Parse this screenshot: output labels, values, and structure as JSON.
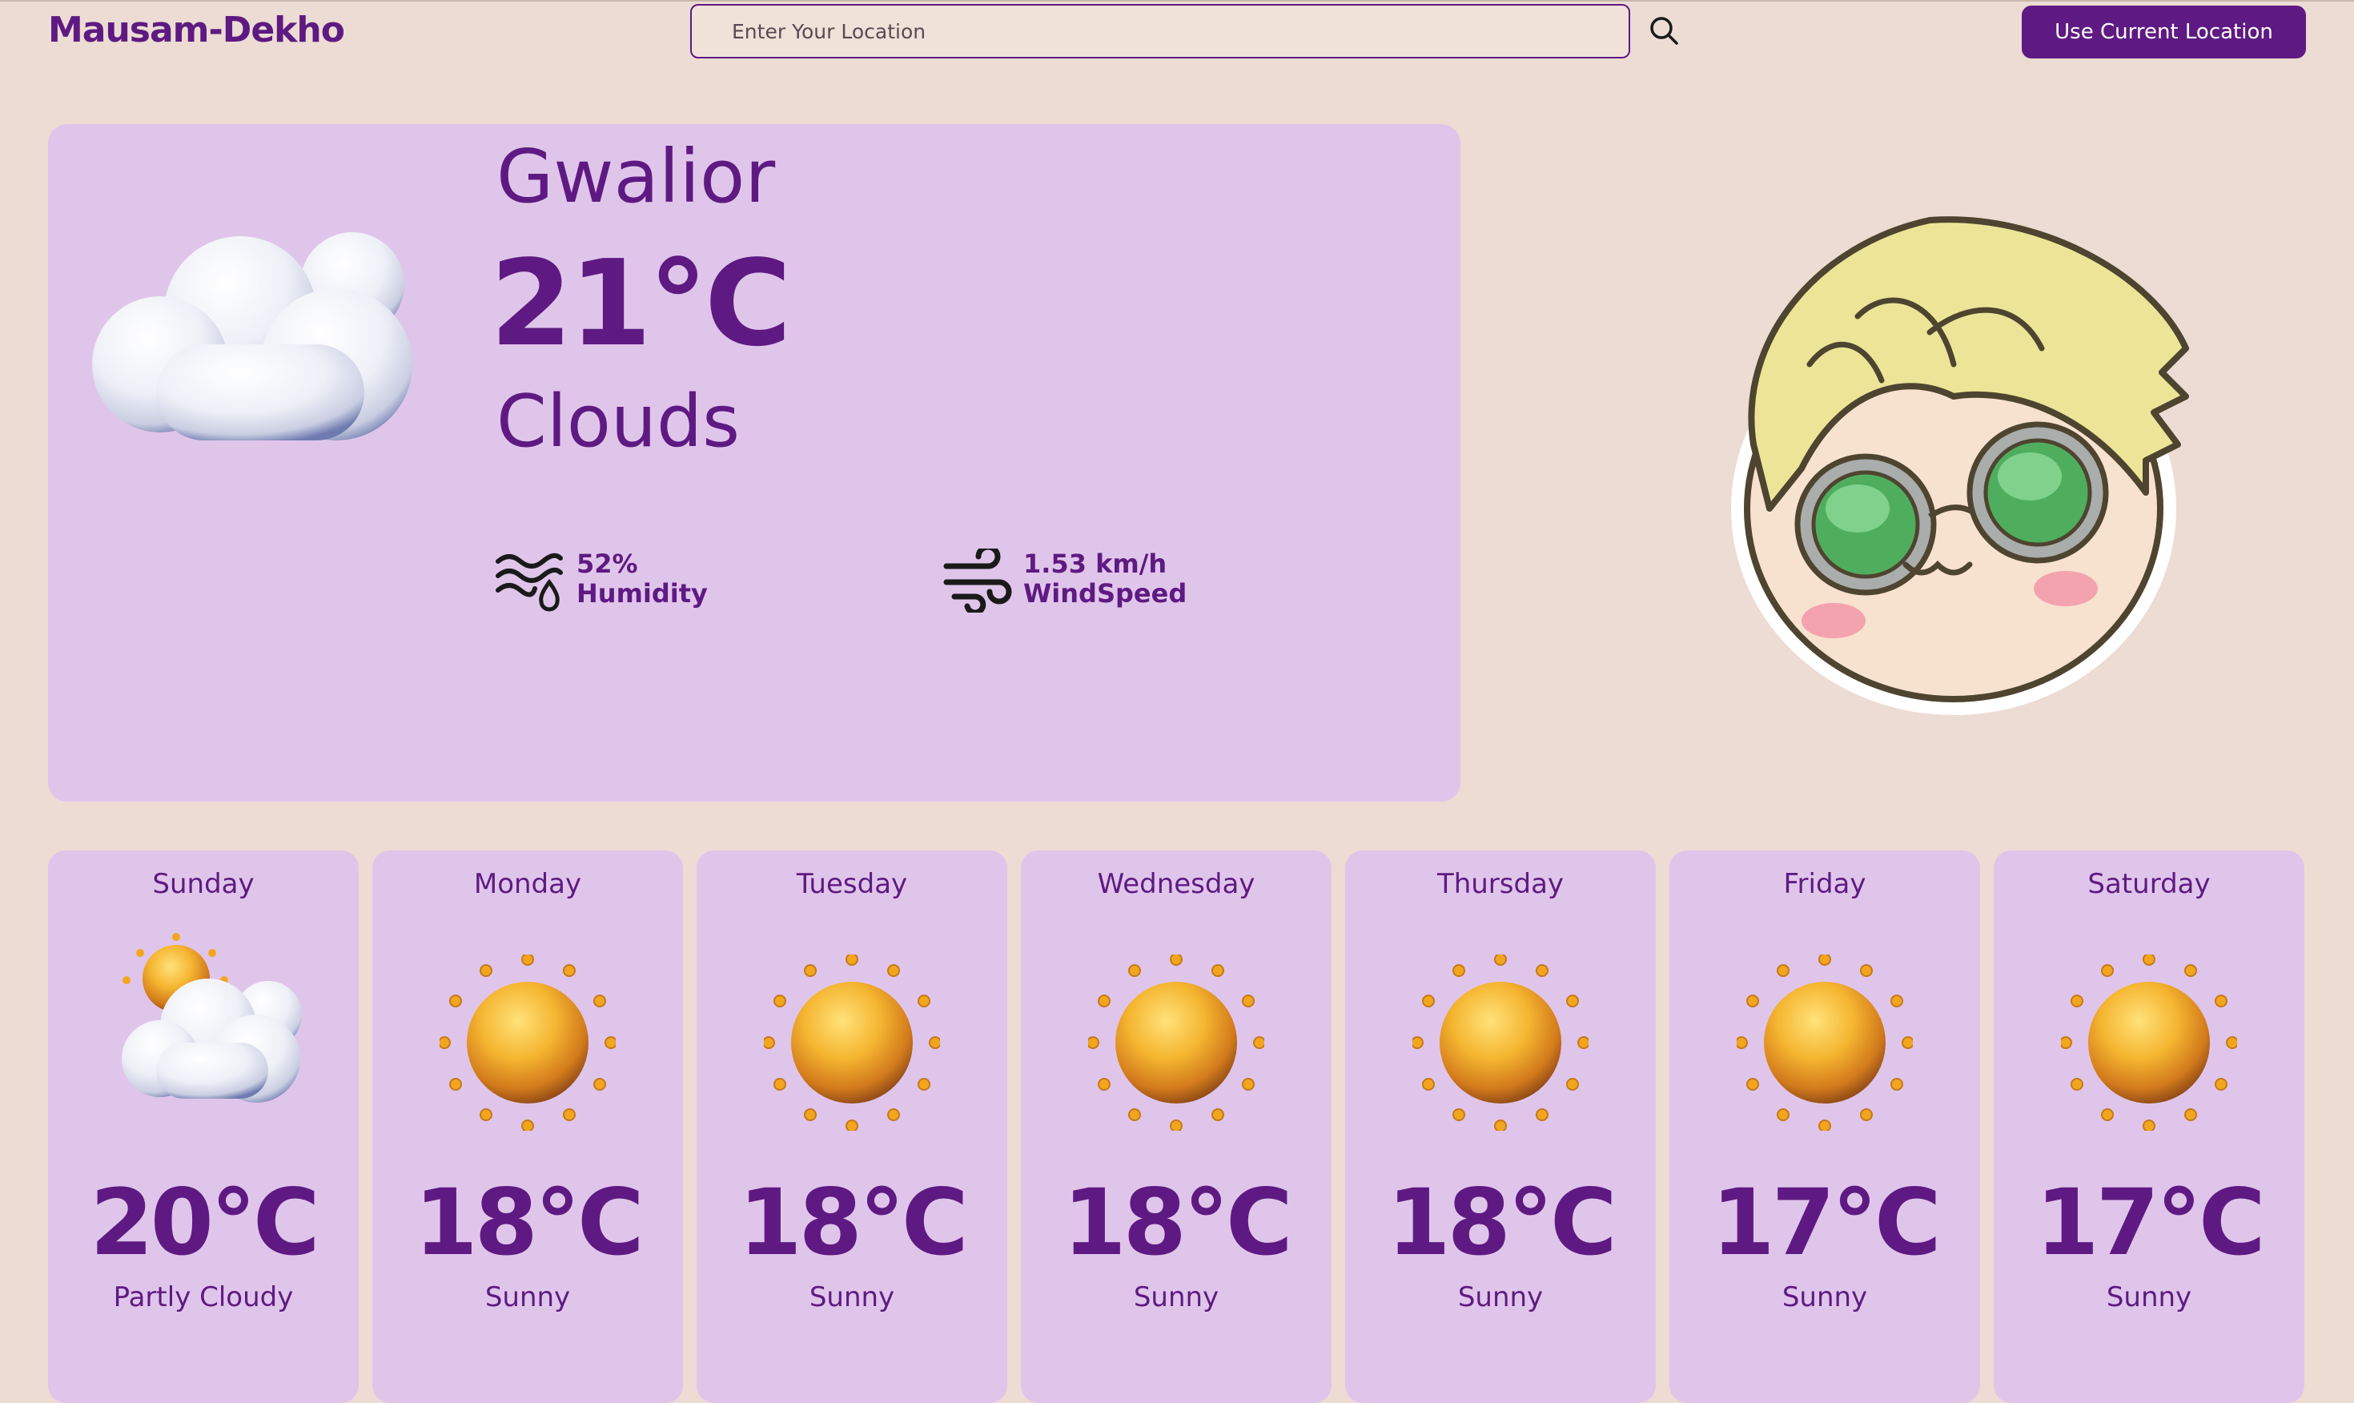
{
  "header": {
    "logo": "Mausam-Dekho",
    "search_placeholder": "Enter Your Location",
    "search_icon": "search-icon",
    "location_button": "Use Current Location"
  },
  "current": {
    "city": "Gwalior",
    "temperature": "21°C",
    "condition": "Clouds",
    "icon": "cloud-icon",
    "humidity": {
      "value": "52%",
      "label": "Humidity",
      "icon": "humidity-icon"
    },
    "wind": {
      "value": "1.53 km/h",
      "label": "WindSpeed",
      "icon": "wind-icon"
    }
  },
  "mascot": "cartoon-avatar",
  "forecast": [
    {
      "day": "Sunday",
      "temp": "20°C",
      "condition": "Partly Cloudy",
      "icon": "partly-cloudy-icon"
    },
    {
      "day": "Monday",
      "temp": "18°C",
      "condition": "Sunny",
      "icon": "sun-icon"
    },
    {
      "day": "Tuesday",
      "temp": "18°C",
      "condition": "Sunny",
      "icon": "sun-icon"
    },
    {
      "day": "Wednesday",
      "temp": "18°C",
      "condition": "Sunny",
      "icon": "sun-icon"
    },
    {
      "day": "Thursday",
      "temp": "18°C",
      "condition": "Sunny",
      "icon": "sun-icon"
    },
    {
      "day": "Friday",
      "temp": "17°C",
      "condition": "Sunny",
      "icon": "sun-icon"
    },
    {
      "day": "Saturday",
      "temp": "17°C",
      "condition": "Sunny",
      "icon": "sun-icon"
    }
  ],
  "colors": {
    "background": "#ecdcd3",
    "card": "#e0c5ea",
    "accent": "#5e1a82",
    "sun": "#f2a61e",
    "cloud": "#e8ecf4"
  }
}
